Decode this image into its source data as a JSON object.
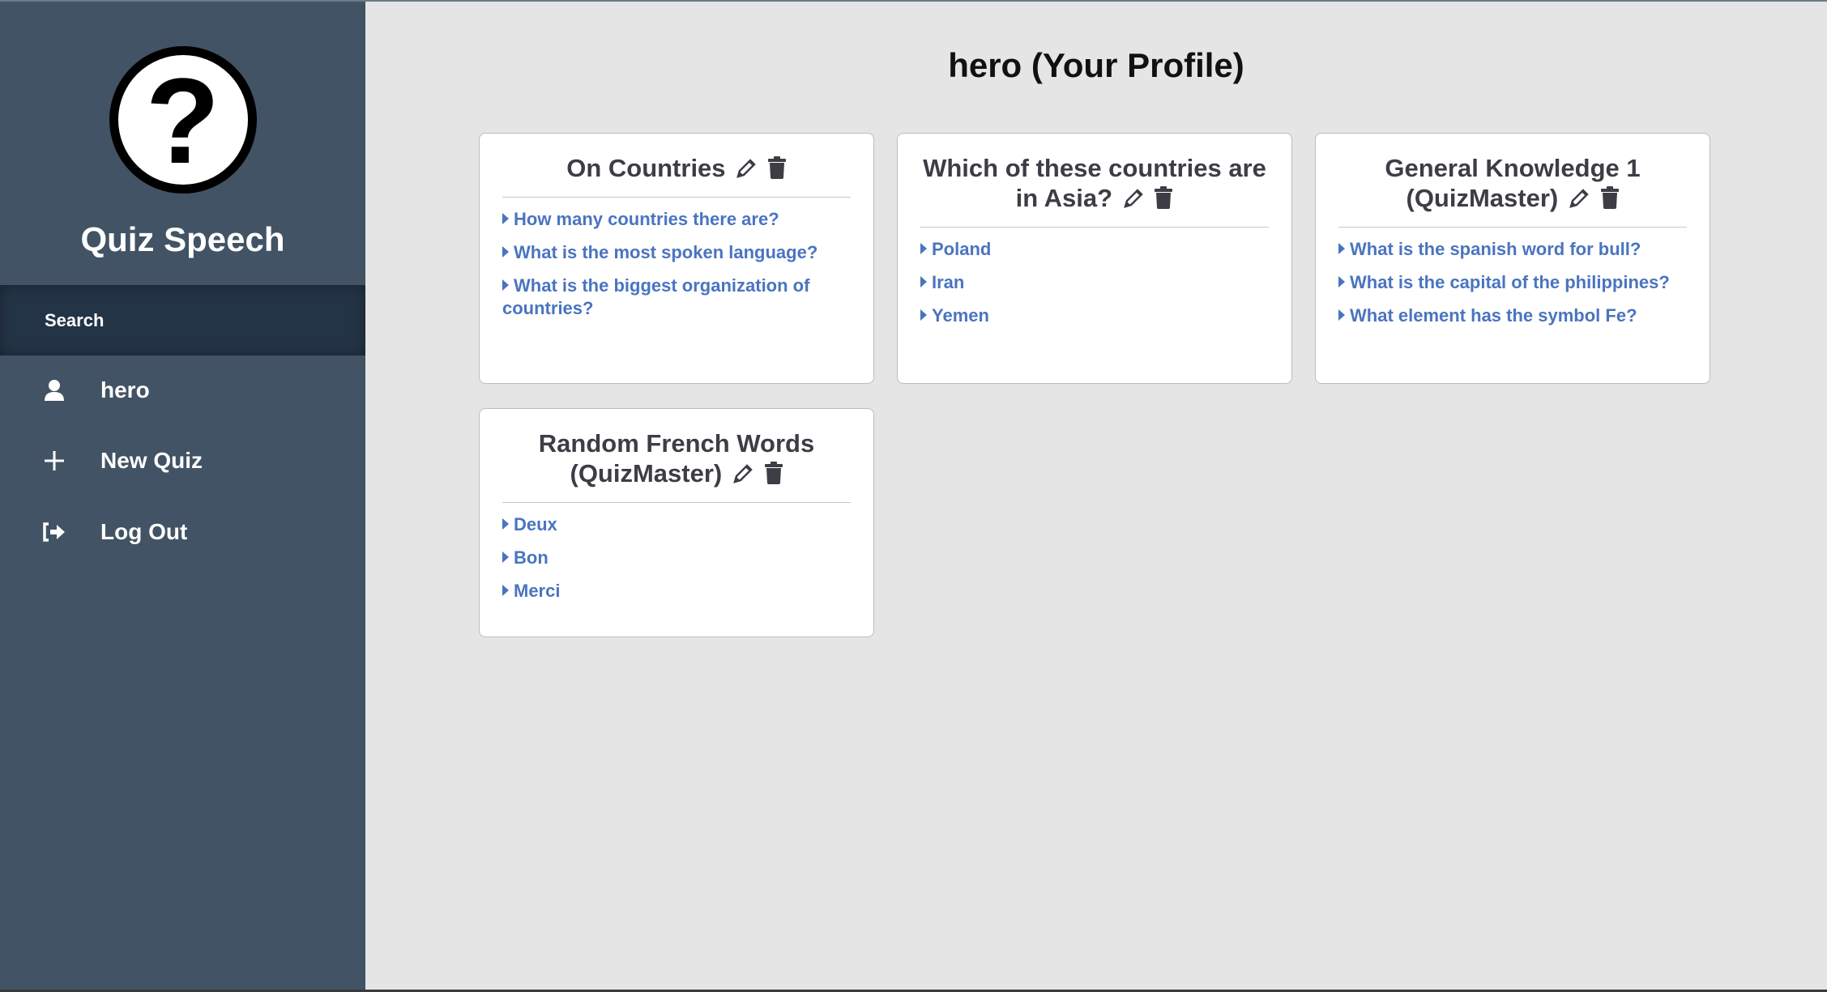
{
  "sidebar": {
    "logo_icon": "question-circle-icon",
    "brand": "Quiz Speech",
    "search_label": "Search",
    "items": [
      {
        "label": "hero",
        "icon": "user-icon"
      },
      {
        "label": "New Quiz",
        "icon": "plus-icon"
      },
      {
        "label": "Log Out",
        "icon": "sign-out-icon"
      }
    ]
  },
  "main": {
    "title": "hero (Your Profile)",
    "colors": {
      "link": "#4a74c0",
      "title": "#3d3d45",
      "sidebar": "#415364"
    },
    "quizzes": [
      {
        "title": "On Countries",
        "questions": [
          "How many countries there are?",
          "What is the most spoken language?",
          "What is the biggest organization of countries?"
        ]
      },
      {
        "title": "Which of these countries are in Asia?",
        "questions": [
          "Poland",
          "Iran",
          "Yemen"
        ]
      },
      {
        "title": "General Knowledge 1 (QuizMaster)",
        "questions": [
          "What is the spanish word for bull?",
          "What is the capital of the philippines?",
          "What element has the symbol Fe?"
        ]
      },
      {
        "title": "Random French Words (QuizMaster)",
        "questions": [
          "Deux",
          "Bon",
          "Merci"
        ]
      }
    ]
  }
}
